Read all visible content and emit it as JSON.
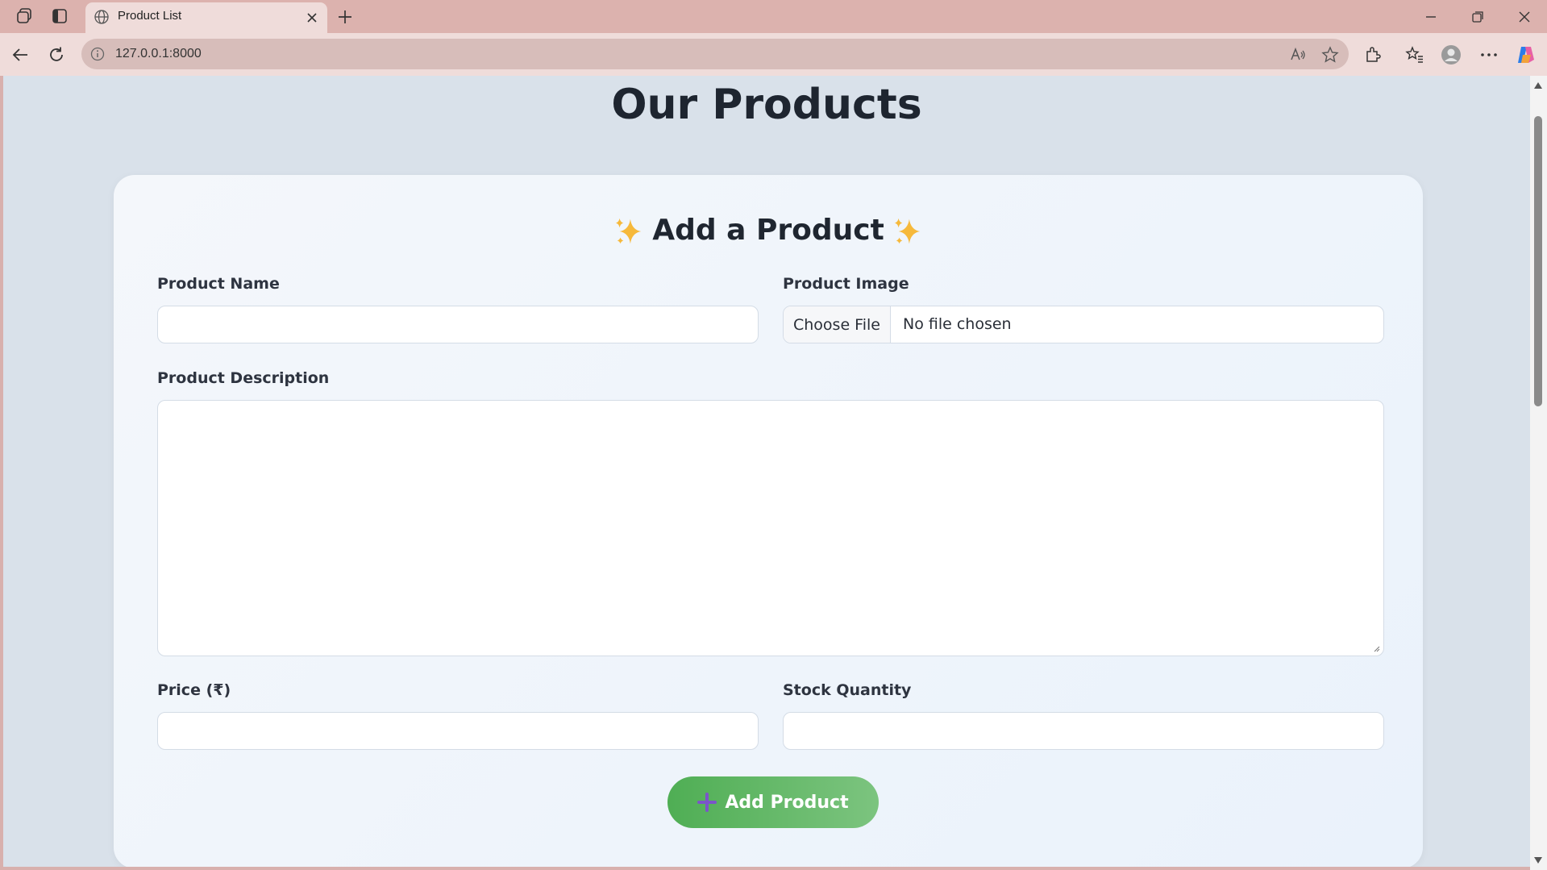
{
  "browser": {
    "tab_title": "Product List",
    "url": "127.0.0.1:8000"
  },
  "page": {
    "title": "Our Products"
  },
  "form": {
    "title": "Add a Product",
    "product_name_label": "Product Name",
    "product_name_value": "",
    "product_image_label": "Product Image",
    "choose_file_label": "Choose File",
    "file_status": "No file chosen",
    "description_label": "Product Description",
    "description_value": "",
    "price_label": "Price (₹)",
    "price_value": "",
    "stock_label": "Stock Quantity",
    "stock_value": "",
    "submit_label": "Add Product"
  },
  "colors": {
    "accent_green": "#4fae54",
    "plus_icon": "#7b55c9"
  }
}
